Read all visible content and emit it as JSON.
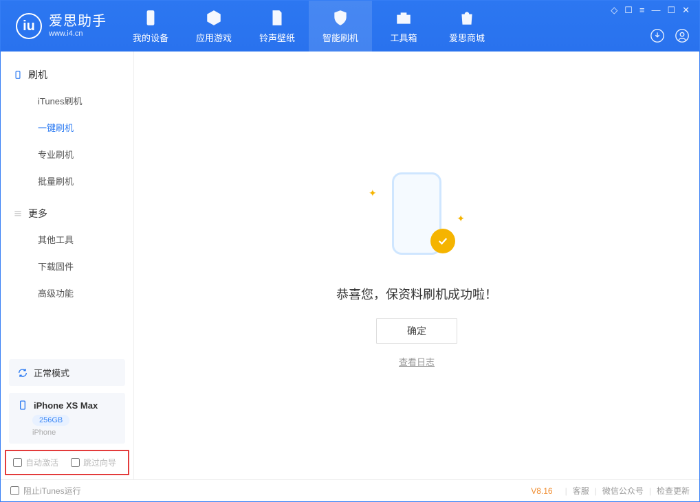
{
  "app": {
    "name": "爱思助手",
    "url": "www.i4.cn"
  },
  "nav": {
    "device": "我的设备",
    "apps": "应用游戏",
    "ring": "铃声壁纸",
    "flash": "智能刷机",
    "toolbox": "工具箱",
    "store": "爱思商城"
  },
  "sidebar": {
    "group1": "刷机",
    "items1": {
      "itunes": "iTunes刷机",
      "oneclick": "一键刷机",
      "pro": "专业刷机",
      "batch": "批量刷机"
    },
    "group2": "更多",
    "items2": {
      "other": "其他工具",
      "firmware": "下载固件",
      "advanced": "高级功能"
    }
  },
  "device": {
    "mode": "正常模式",
    "name": "iPhone XS Max",
    "storage": "256GB",
    "type": "iPhone"
  },
  "options": {
    "autoactivate": "自动激活",
    "skipguide": "跳过向导"
  },
  "main": {
    "success": "恭喜您，保资料刷机成功啦！",
    "ok": "确定",
    "viewlog": "查看日志"
  },
  "footer": {
    "blockitunes": "阻止iTunes运行",
    "version": "V8.16",
    "service": "客服",
    "wechat": "微信公众号",
    "update": "检查更新"
  }
}
